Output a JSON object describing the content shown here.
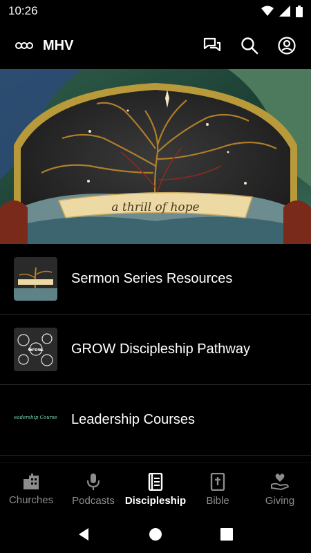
{
  "status": {
    "time": "10:26"
  },
  "app": {
    "title": "MHV"
  },
  "hero": {
    "banner_text": "a thrill of hope"
  },
  "list": {
    "items": [
      {
        "label": "Sermon Series Resources"
      },
      {
        "label": "GROW Discipleship Pathway"
      },
      {
        "label": "Leadership Courses"
      }
    ],
    "grow_thumb_text": "Grow.",
    "leadership_thumb_text": "Leadership Courses"
  },
  "nav": {
    "items": [
      {
        "label": "Churches",
        "icon": "buildings-icon"
      },
      {
        "label": "Podcasts",
        "icon": "microphone-icon"
      },
      {
        "label": "Discipleship",
        "icon": "book-icon",
        "active": true
      },
      {
        "label": "Bible",
        "icon": "bible-icon"
      },
      {
        "label": "Giving",
        "icon": "heart-hand-icon"
      }
    ]
  },
  "colors": {
    "accent": "#ffffff",
    "inactive": "#8c8c8c",
    "background": "#000000"
  }
}
